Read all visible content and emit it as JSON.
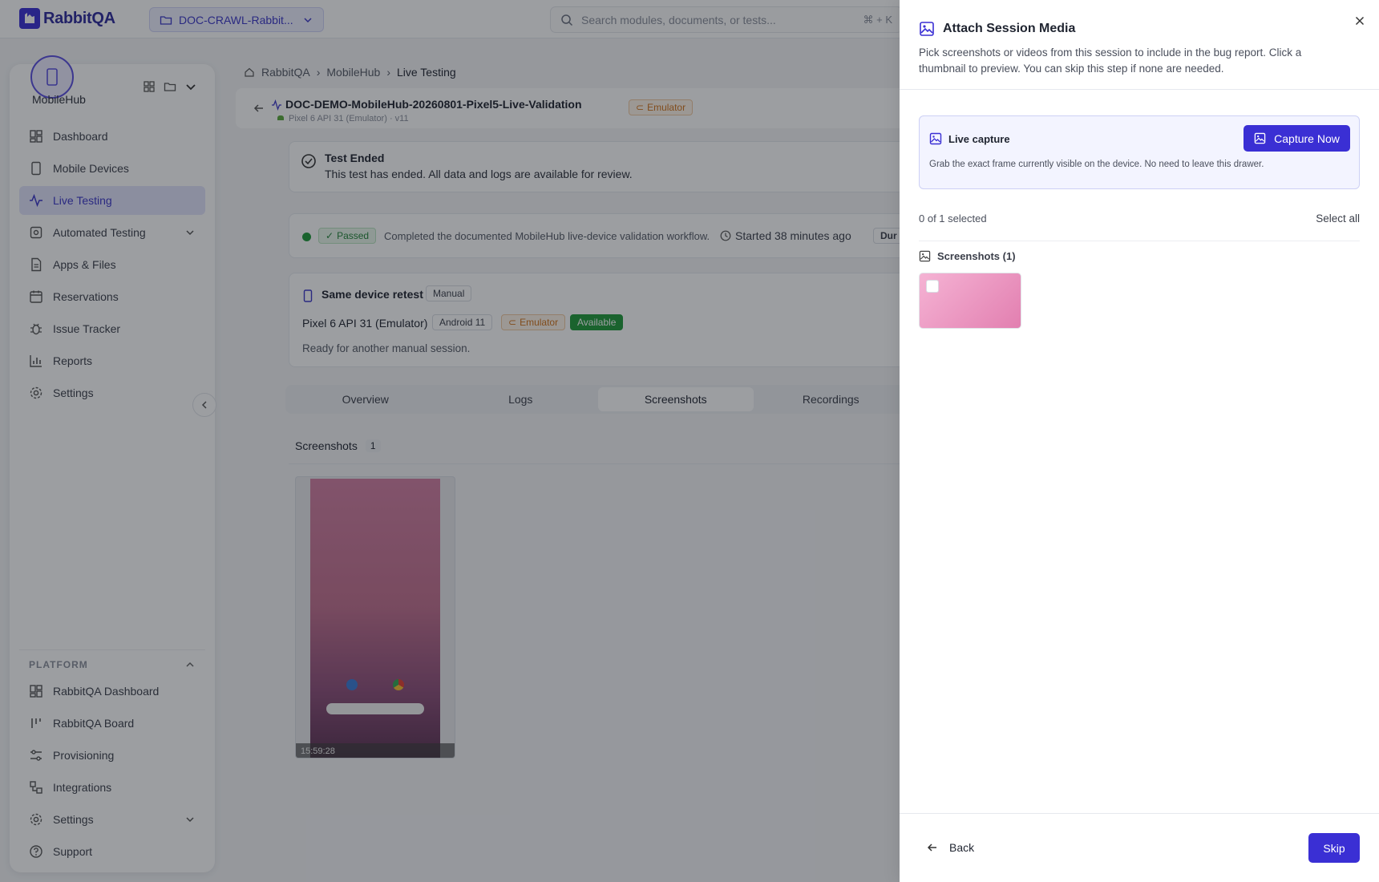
{
  "app": {
    "name": "RabbitQA"
  },
  "header": {
    "project": "DOC-CRAWL-Rabbit...",
    "search_placeholder": "Search modules, documents, or tests...",
    "search_shortcut": "⌘ + K"
  },
  "sidebar": {
    "workspace": "MobileHub",
    "items": [
      {
        "label": "Dashboard",
        "icon": "dashboard-icon"
      },
      {
        "label": "Mobile Devices",
        "icon": "phone-icon"
      },
      {
        "label": "Live Testing",
        "icon": "activity-icon",
        "active": true
      },
      {
        "label": "Automated Testing",
        "icon": "robot-icon",
        "expandable": true
      },
      {
        "label": "Apps & Files",
        "icon": "file-icon"
      },
      {
        "label": "Reservations",
        "icon": "calendar-icon"
      },
      {
        "label": "Issue Tracker",
        "icon": "bug-icon"
      },
      {
        "label": "Reports",
        "icon": "bar-chart-icon"
      },
      {
        "label": "Settings",
        "icon": "gear-icon"
      }
    ],
    "platform_label": "PLATFORM",
    "platform_items": [
      {
        "label": "RabbitQA Dashboard",
        "icon": "dashboard-icon"
      },
      {
        "label": "RabbitQA Board",
        "icon": "board-icon"
      },
      {
        "label": "Provisioning",
        "icon": "sliders-icon"
      },
      {
        "label": "Integrations",
        "icon": "plug-icon"
      },
      {
        "label": "Settings",
        "icon": "gear-icon",
        "expandable": true
      },
      {
        "label": "Support",
        "icon": "help-icon"
      }
    ]
  },
  "breadcrumb": [
    "RabbitQA",
    "MobileHub",
    "Live Testing"
  ],
  "session": {
    "title": "DOC-DEMO-MobileHub-20260801-Pixel5-Live-Validation",
    "subtitle": "Pixel 6 API 31 (Emulator) · v11",
    "type_badge": "Emulator"
  },
  "test_ended": {
    "title": "Test Ended",
    "message": "This test has ended. All data and logs are available for review."
  },
  "status": {
    "result": "Passed",
    "summary": "Completed the documented MobileHub live-device validation workflow.",
    "started": "Started 38 minutes ago",
    "duration_label": "Dur"
  },
  "retest": {
    "title": "Same device retest",
    "mode": "Manual",
    "device": "Pixel 6 API 31 (Emulator)",
    "os": "Android 11",
    "type": "Emulator",
    "availability": "Available",
    "note": "Ready for another manual session."
  },
  "tabs": [
    "Overview",
    "Logs",
    "Screenshots",
    "Recordings"
  ],
  "active_tab": "Screenshots",
  "screenshots_section": {
    "label": "Screenshots",
    "count": "1",
    "timestamp": "15:59:28"
  },
  "drawer": {
    "title": "Attach Session Media",
    "description": "Pick screenshots or videos from this session to include in the bug report. Click a thumbnail to preview. You can skip this step if none are needed.",
    "live_capture_label": "Live capture",
    "live_capture_desc": "Grab the exact frame currently visible on the device. No need to leave this drawer.",
    "capture_button": "Capture Now",
    "selected_text": "0 of 1 selected",
    "select_all": "Select all",
    "screenshots_group": "Screenshots (1)",
    "back": "Back",
    "skip": "Skip"
  },
  "colors": {
    "accent": "#3a2fd4",
    "success": "#1f9a3a",
    "warning": "#d0741c"
  }
}
